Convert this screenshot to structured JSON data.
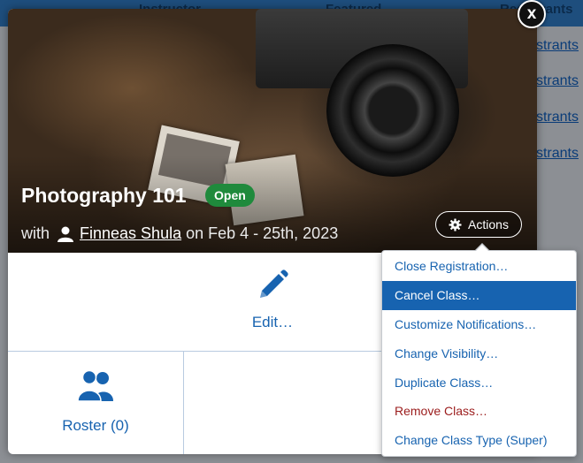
{
  "background": {
    "header_cols": [
      "Instructor",
      "Featured",
      "Registrants"
    ],
    "links": [
      "Registrants",
      "Registrants",
      "Registrants",
      "Registrants"
    ]
  },
  "modal": {
    "title": "Photography 101",
    "status": "Open",
    "byline_prefix": "with",
    "instructor": "Finneas Shula",
    "dates": "on Feb 4 - 25th, 2023",
    "actions_label": "Actions",
    "close_label": "x",
    "edit_label": "Edit…",
    "roster_label": "Roster (0)"
  },
  "menu": {
    "items": [
      {
        "label": "Close Registration…",
        "state": "normal"
      },
      {
        "label": "Cancel Class…",
        "state": "active"
      },
      {
        "label": "Customize Notifications…",
        "state": "normal"
      },
      {
        "label": "Change Visibility…",
        "state": "normal"
      },
      {
        "label": "Duplicate Class…",
        "state": "normal"
      },
      {
        "label": "Remove Class…",
        "state": "danger"
      },
      {
        "label": "Change Class Type (Super)",
        "state": "normal"
      }
    ]
  },
  "colors": {
    "accent": "#1763b0",
    "status_green": "#1f8a3c",
    "danger": "#9b1c1c"
  }
}
